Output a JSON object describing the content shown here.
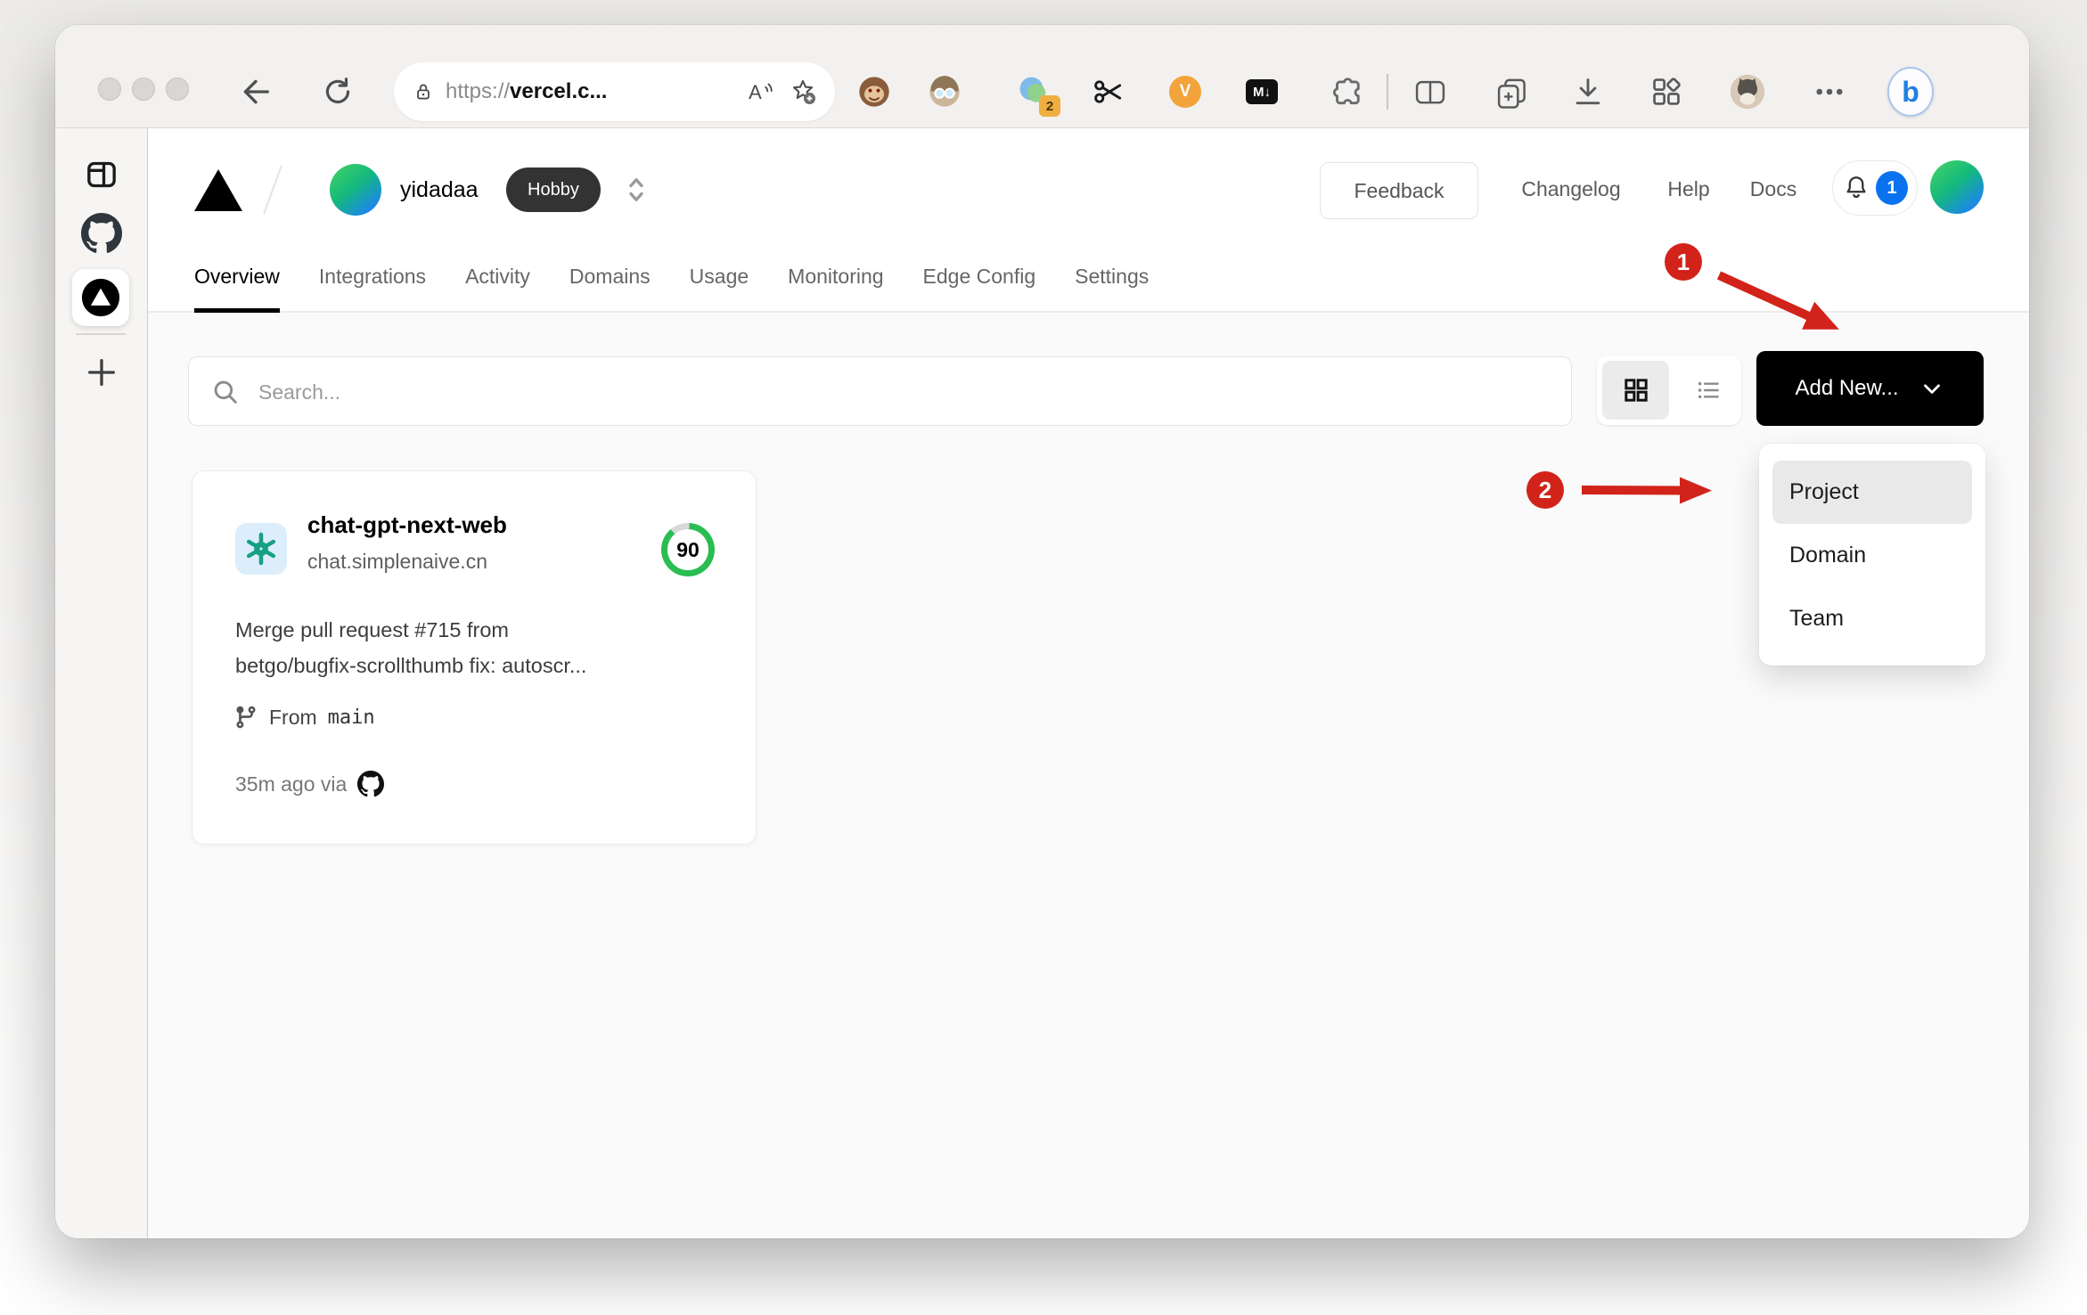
{
  "colors": {
    "annotation_red": "#d2231a",
    "notification_blue": "#0b72ef",
    "gauge_green": "#29bd52",
    "add_new_button_bg": "#000000",
    "plan_badge_bg": "#333333",
    "openai_teal": "#17a083",
    "openai_logo_bg": "#dceefb"
  },
  "browser": {
    "url": {
      "scheme": "https://",
      "host": "vercel.c..."
    },
    "reader_letter": "A",
    "extensions": {
      "translator_badge": "2",
      "v_label": "V",
      "markdown_label": "M↓",
      "bing_label": "b"
    }
  },
  "vercel": {
    "team": {
      "name": "yidadaa",
      "plan": "Hobby"
    },
    "header_links": {
      "feedback": "Feedback",
      "changelog": "Changelog",
      "help": "Help",
      "docs": "Docs"
    },
    "notification_count": "1",
    "tabs": [
      {
        "label": "Overview"
      },
      {
        "label": "Integrations"
      },
      {
        "label": "Activity"
      },
      {
        "label": "Domains"
      },
      {
        "label": "Usage"
      },
      {
        "label": "Monitoring"
      },
      {
        "label": "Edge Config"
      },
      {
        "label": "Settings"
      }
    ],
    "search_placeholder": "Search...",
    "add_new_label": "Add New...",
    "dropdown": {
      "items": [
        {
          "label": "Project"
        },
        {
          "label": "Domain"
        },
        {
          "label": "Team"
        }
      ]
    },
    "project_card": {
      "name": "chat-gpt-next-web",
      "domain": "chat.simplenaive.cn",
      "score": "90",
      "commit_line1": "Merge pull request #715 from",
      "commit_line2": "betgo/bugfix-scrollthumb fix: autoscr...",
      "branch_label": "From",
      "branch_name": "main",
      "deploy_meta": "35m ago via"
    }
  },
  "annotations": {
    "step1": "1",
    "step2": "2"
  }
}
